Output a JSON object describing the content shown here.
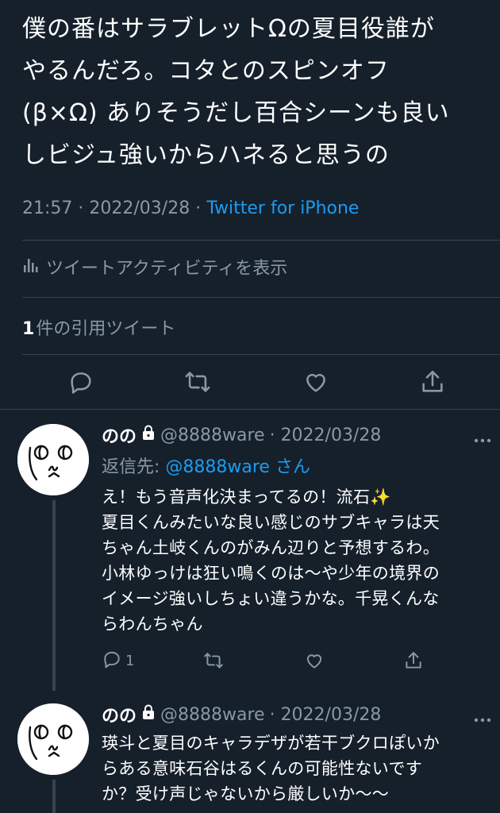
{
  "tweet": {
    "text": "僕の番はサラブレットΩの夏目役誰が\nやるんだろ。コタとのスピンオフ\n(β×Ω) ありそうだし百合シーンも良い\nしビジュ強いからハネると思うの",
    "time": "21:57",
    "date": "2022/03/28",
    "separator": "·",
    "source": "Twitter for iPhone",
    "activity_label": "ツイートアクティビティを表示",
    "quote_count": "1",
    "quote_label": "件の引用ツイート"
  },
  "colors": {
    "background": "#15202b",
    "text": "#ffffff",
    "secondary": "#8899a6",
    "link": "#1d9bf0",
    "divider": "#38444d"
  },
  "icons": {
    "reply": "reply-icon",
    "retweet": "retweet-icon",
    "like": "heart-icon",
    "share": "share-icon",
    "activity": "bar-chart-icon",
    "lock": "lock-icon",
    "more": "more-dots-icon"
  },
  "replies": [
    {
      "name": "のの",
      "handle": "@8888ware",
      "date": "· 2022/03/28",
      "reply_to_label": "返信先: ",
      "reply_to_handle": "@8888ware",
      "reply_to_suffix": "さん",
      "text_part1": "え！もう音声化決まってるの！流石",
      "emoji": "✨",
      "text_part2": "\n夏目くんみたいな良い感じのサブキャラは天\nちゃん土岐くんのがみん辺りと予想するわ。\n小林ゆっけは狂い鳴くのは〜や少年の境界の\nイメージ強いしちょい違うかな。千晃くんな\nらわんちゃん",
      "reply_count": "1"
    },
    {
      "name": "のの",
      "handle": "@8888ware",
      "date": "· 2022/03/28",
      "text": "瑛斗と夏目のキャラデザが若干ブクロぽいか\nらある意味石谷はるくんの可能性ないです\nか？受け声じゃないから厳しいか〜〜"
    }
  ]
}
